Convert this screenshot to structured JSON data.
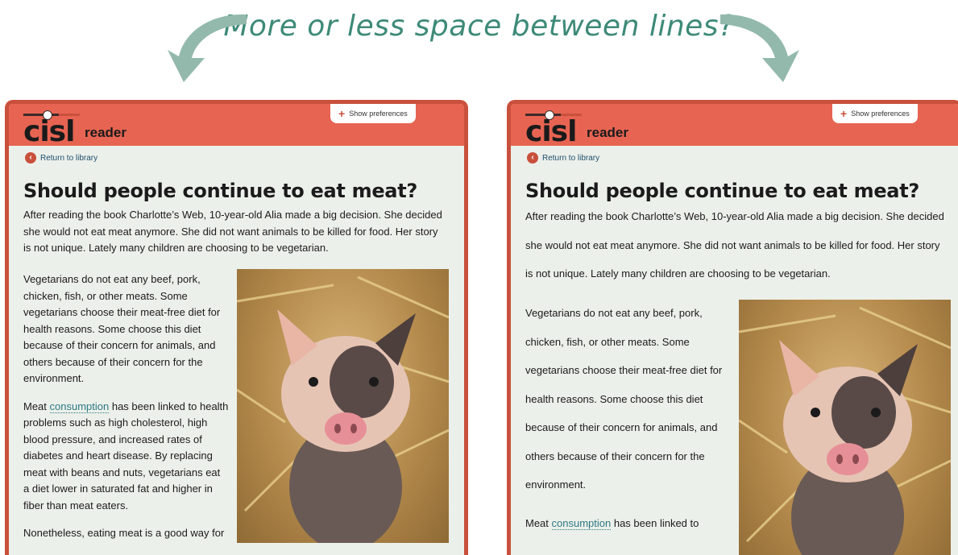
{
  "headline": "More or less space between lines?",
  "app": {
    "logo_word": "cisl",
    "logo_sub": "reader",
    "prefs_label": "Show preferences",
    "return_label": "Return to library"
  },
  "article": {
    "title": "Should people continue to eat meat?",
    "intro": "After reading the book Charlotte’s Web, 10-year-old Alia made a big decision. She decided she would not eat meat anymore. She did not want animals to be killed for food. Her story is not unique. Lately many children are choosing to be vegetarian.",
    "p1": "Vegetarians do not eat any beef, pork, chicken, fish, or other meats. Some vegetarians choose their meat-free diet for health reasons. Some choose this diet because of their concern for animals, and others because of their concern for the environment.",
    "p2_prefix": "Meat ",
    "p2_link": "consumption",
    "p2_rest": " has been linked to health problems such as high cholesterol, high blood pressure, and increased rates of diabetes and heart disease. By replacing meat with beans and nuts, vegetarians eat a diet lower in saturated fat and higher in fiber than meat eaters.",
    "p3": "Nonetheless, eating meat is a good way for",
    "p2_short_rest": " has been linked to"
  },
  "colors": {
    "accent": "#e76452",
    "border": "#c9503c",
    "panel_bg": "#ecf0ea",
    "headline": "#3d8a78"
  }
}
